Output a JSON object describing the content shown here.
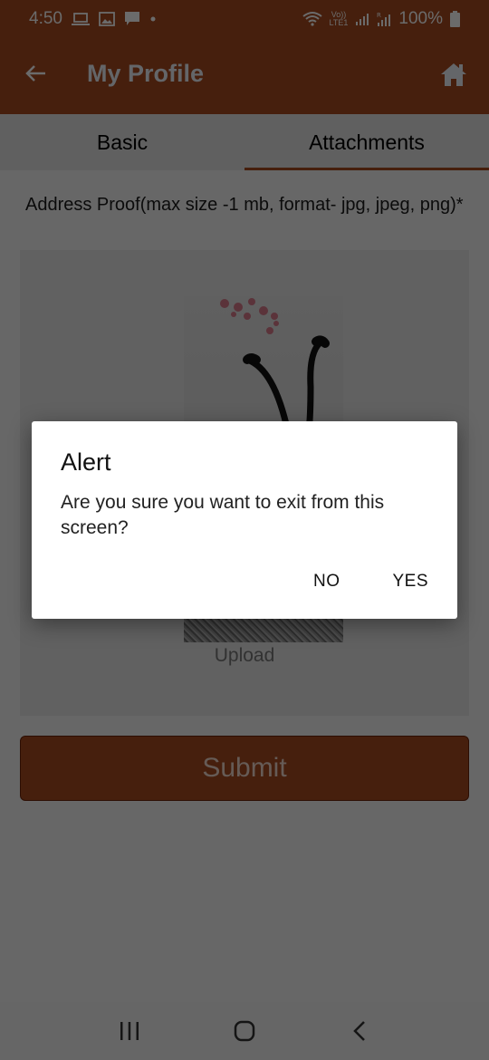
{
  "status_bar": {
    "time": "4:50",
    "notification_icons": [
      "laptop-icon",
      "image-icon",
      "message-icon",
      "dot-icon"
    ],
    "system_icons": [
      "wifi-icon",
      "volte-lte-icon",
      "signal-icon",
      "roaming-signal-icon"
    ],
    "network_label": "Vo)) LTE1",
    "battery_percent": "100%"
  },
  "app_bar": {
    "title": "My Profile",
    "back_icon": "arrow-left-icon",
    "home_icon": "home-icon"
  },
  "tabs": [
    {
      "label": "Basic",
      "active": false
    },
    {
      "label": "Attachments",
      "active": true
    }
  ],
  "form": {
    "address_proof_label": "Address Proof(max size -1 mb, format- jpg, jpeg, png)*",
    "upload_label": "Upload",
    "submit_label": "Submit"
  },
  "dialog": {
    "title": "Alert",
    "message": "Are you sure you want to exit from this screen?",
    "no_label": "NO",
    "yes_label": "YES"
  },
  "nav_bar": {
    "buttons": [
      "recent-apps-icon",
      "home-circle-icon",
      "back-chevron-icon"
    ]
  },
  "colors": {
    "brand": "#a64a1f",
    "dimmed_brand": "#5e2d15",
    "scrim": "rgba(0,0,0,0.58)",
    "dialog_bg": "#ffffff"
  }
}
